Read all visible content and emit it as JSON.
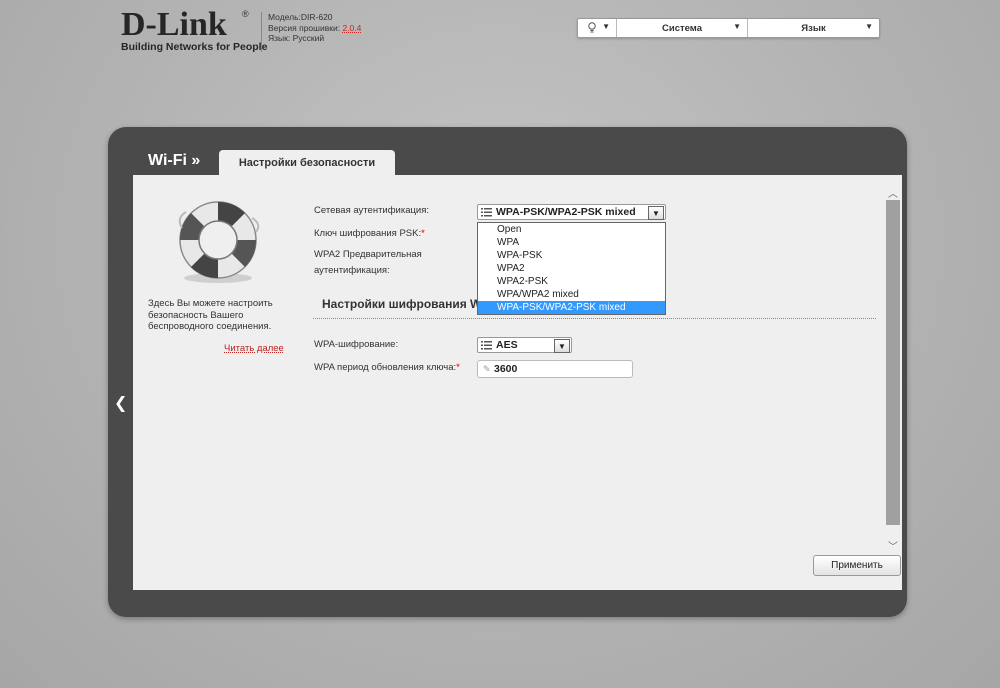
{
  "header": {
    "logo": {
      "main": "D-Link",
      "reg": "®",
      "tagline": "Building Networks for People"
    },
    "device": {
      "model": "Модель:DIR-620",
      "firmware_label": "Версия прошивки:",
      "firmware_value": "2.0.4",
      "language": "Язык: Русский"
    },
    "menu": {
      "hint_icon": "bulb-icon",
      "system": "Система",
      "language": "Язык"
    }
  },
  "breadcrumb": {
    "section": "Wi-Fi »",
    "tab": "Настройки безопасности"
  },
  "sidebar": {
    "help_text": "Здесь Вы можете настроить безопасность Вашего беспроводного соединения.",
    "read_more": "Читать далее",
    "icon": "lifebuoy-icon"
  },
  "form": {
    "auth_label": "Сетевая аутентификация:",
    "auth_value": "WPA-PSK/WPA2-PSK mixed",
    "auth_options": [
      "Open",
      "WPA",
      "WPA-PSK",
      "WPA2",
      "WPA2-PSK",
      "WPA/WPA2 mixed",
      "WPA-PSK/WPA2-PSK mixed"
    ],
    "psk_label": "Ключ шифрования PSK:",
    "preauth_label_line1": "WPA2 Предварительная",
    "preauth_label_line2": "аутентификация:",
    "section_title": "Настройки шифрования W",
    "enc_label": "WPA-шифрование:",
    "enc_value": "AES",
    "rekey_label": "WPA период обновления ключа:",
    "rekey_value": "3600",
    "required_mark": "*"
  },
  "buttons": {
    "apply": "Применить"
  },
  "colors": {
    "accent": "#3399ff",
    "panel": "#4a4a4a",
    "link": "#bb2222"
  }
}
